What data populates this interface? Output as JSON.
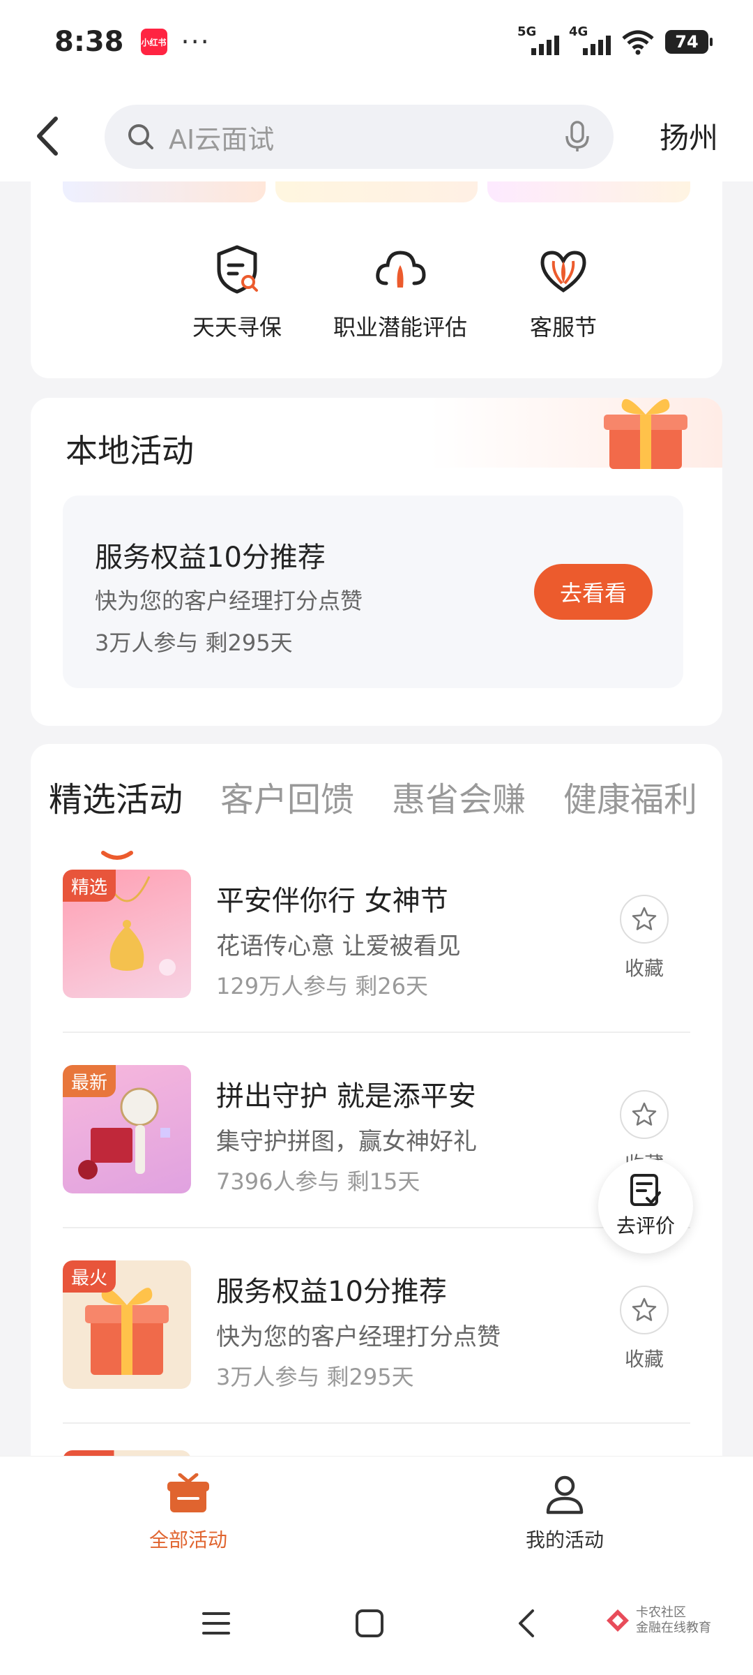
{
  "status_bar": {
    "time": "8:38",
    "app_badge": "小红书",
    "dots": "···",
    "net1": "5G",
    "net2": "4G",
    "battery": "74"
  },
  "header": {
    "search_placeholder": "AI云面试",
    "city": "扬州"
  },
  "services": [
    {
      "label": "天天寻保",
      "icon": "shield-search-icon"
    },
    {
      "label": "职业潜能评估",
      "icon": "cloud-rocket-icon"
    },
    {
      "label": "客服节",
      "icon": "heart-icon"
    }
  ],
  "local": {
    "title": "本地活动",
    "card_title": "服务权益10分推荐",
    "card_sub": "快为您的客户经理打分点赞",
    "card_meta": "3万人参与   剩295天",
    "button": "去看看"
  },
  "tabs": [
    {
      "label": "精选活动",
      "active": true
    },
    {
      "label": "客户回馈",
      "active": false
    },
    {
      "label": "惠省会赚",
      "active": false
    },
    {
      "label": "健康福利",
      "active": false
    }
  ],
  "activities": [
    {
      "tag": "精选",
      "title": "平安伴你行 女神节",
      "sub": "花语传心意 让爱被看见",
      "meta": "129万人参与    剩26天",
      "fav": "收藏"
    },
    {
      "tag": "最新",
      "title": "拼出守护 就是添平安",
      "sub": "集守护拼图，赢女神好礼",
      "meta": "7396人参与    剩15天",
      "fav": "收藏"
    },
    {
      "tag": "最火",
      "title": "服务权益10分推荐",
      "sub": "快为您的客户经理打分点赞",
      "meta": "3万人参与    剩295天",
      "fav": "收藏"
    }
  ],
  "review_float": "去评价",
  "bottom_nav": [
    {
      "label": "全部活动",
      "active": true,
      "icon": "gift-icon"
    },
    {
      "label": "我的活动",
      "active": false,
      "icon": "person-icon"
    }
  ],
  "watermark": {
    "line1": "卡农社区",
    "line2": "金融在线教育"
  },
  "colors": {
    "accent": "#ec5b2d",
    "tag": "#e8553b",
    "nav_active": "#e0642f"
  }
}
